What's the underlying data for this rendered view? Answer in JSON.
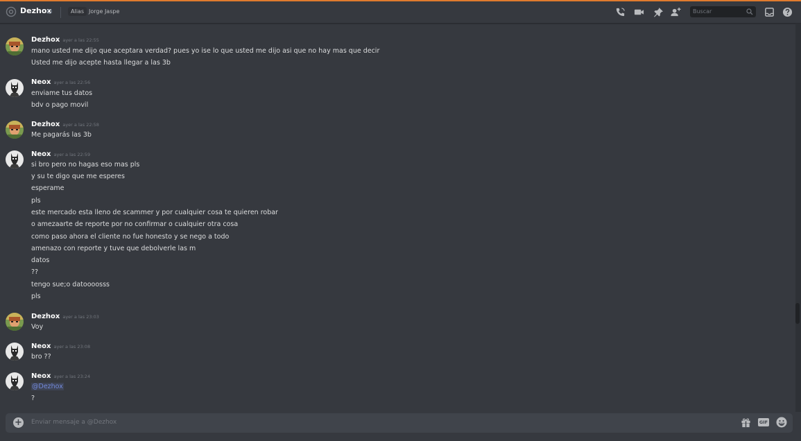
{
  "header": {
    "username": "Dezhox",
    "alias_label": "Alias",
    "alias_value": "Jorge Jaspe",
    "search_placeholder": "Buscar"
  },
  "messages": [
    {
      "author": "Dezhox",
      "timestamp": "ayer a las 22:55",
      "lines": [
        "mano usted me dijo que aceptara verdad? pues yo ise lo que usted me dijo asi que no hay mas que decir",
        "Usted me dijo acepte hasta llegar a las 3b"
      ]
    },
    {
      "author": "Neox",
      "timestamp": "ayer a las 22:56",
      "lines": [
        "enviame tus datos",
        "bdv o pago movil"
      ]
    },
    {
      "author": "Dezhox",
      "timestamp": "ayer a las 22:58",
      "lines": [
        "Me pagarás las 3b"
      ]
    },
    {
      "author": "Neox",
      "timestamp": "ayer a las 22:59",
      "lines": [
        "si bro pero no hagas eso mas pls",
        "y su te digo que me esperes",
        "esperame",
        "pls",
        "este mercado esta lleno de scammer y por cualquier cosa te quieren robar",
        "o amezaarte de reporte por no confirmar o cualquier otra cosa",
        "como paso ahora el cliente no fue honesto y se nego a todo",
        "amenazo con reporte y tuve que debolverle las m",
        "datos",
        "??",
        "tengo sue;o datoooosss",
        "pls"
      ]
    },
    {
      "author": "Dezhox",
      "timestamp": "ayer a las 23:03",
      "lines": [
        "Voy"
      ]
    },
    {
      "author": "Neox",
      "timestamp": "ayer a las 23:08",
      "lines": [
        "bro ??"
      ]
    },
    {
      "author": "Neox",
      "timestamp": "ayer a las 23:24",
      "mention": "@Dezhox",
      "lines": [
        "?"
      ]
    }
  ],
  "composer": {
    "placeholder": "Enviar mensaje a @Dezhox",
    "gif_label": "GIF"
  },
  "icons": [
    "at-icon",
    "call-icon",
    "video-icon",
    "pin-icon",
    "add-friend-icon",
    "search-icon",
    "inbox-icon",
    "help-icon",
    "add-attachment-icon",
    "gift-icon",
    "emoji-icon"
  ],
  "colors": {
    "background": "#36393f",
    "accent": "#7289da",
    "top_line": "#e07b2e"
  }
}
